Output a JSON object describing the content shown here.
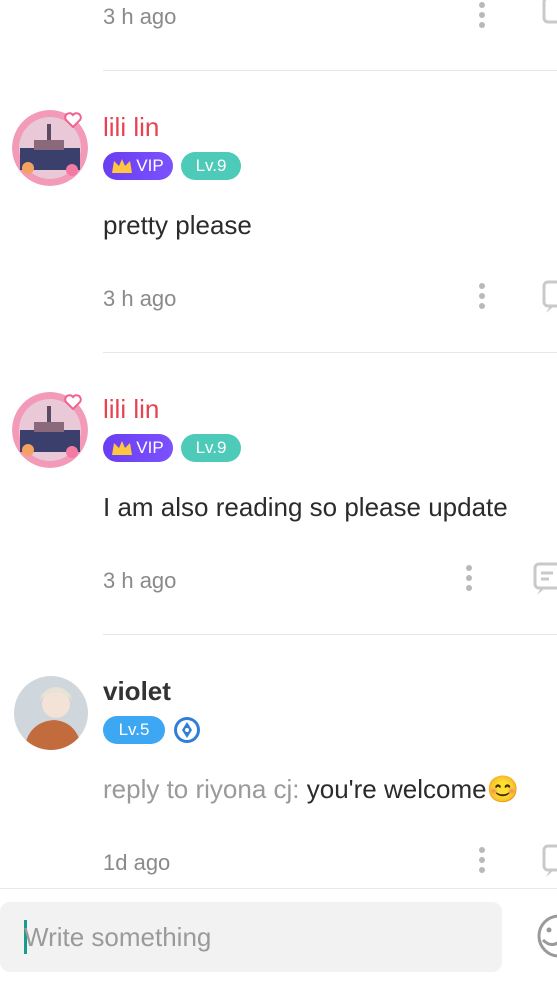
{
  "comments": [
    {
      "id": "c0",
      "time": "3 h ago"
    },
    {
      "id": "c1",
      "name": "lili lin",
      "vip": "VIP",
      "level": "Lv.9",
      "text": "pretty please",
      "time": "3 h ago"
    },
    {
      "id": "c2",
      "name": "lili lin",
      "vip": "VIP",
      "level": "Lv.9",
      "text": "I am also reading so please update",
      "time": "3 h ago"
    },
    {
      "id": "c3",
      "name": "violet",
      "level": "Lv.5",
      "reply_prefix": "reply to riyona cj: ",
      "text": "you're welcome😊",
      "time": "1d ago"
    }
  ],
  "input": {
    "placeholder": "Write something"
  },
  "colors": {
    "name_red": "#e8414f",
    "vip": "#6a3df0",
    "lv9": "#4ecab9",
    "lv5": "#3ea7f3"
  }
}
